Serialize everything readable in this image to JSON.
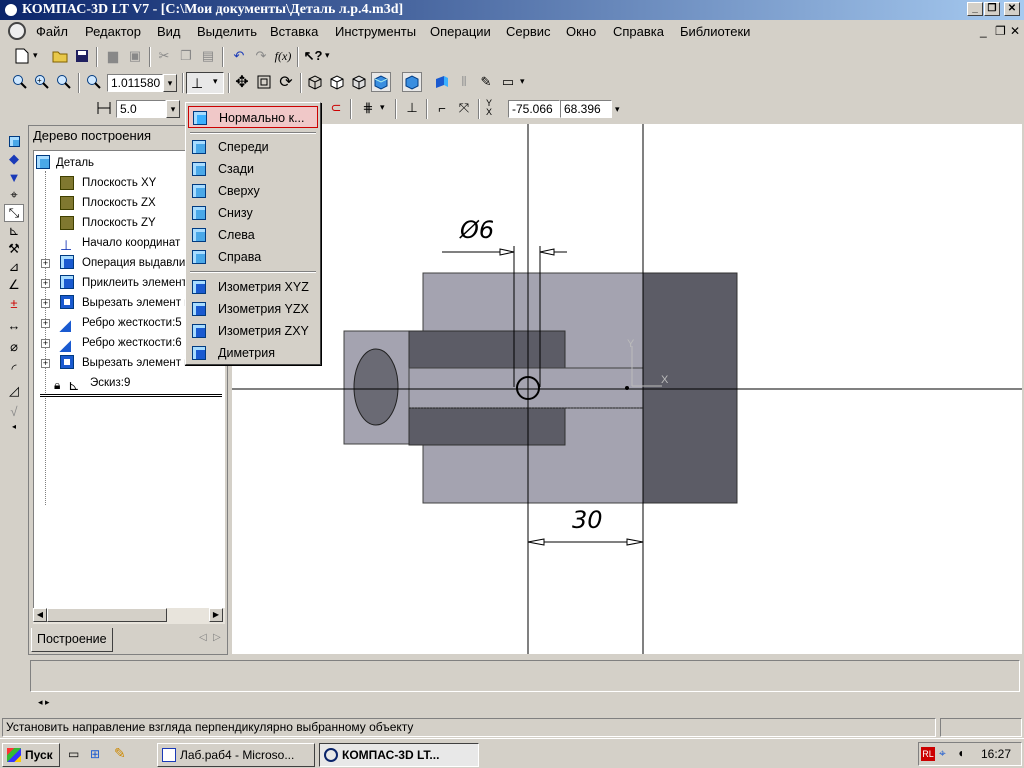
{
  "window": {
    "title": "КОМПАС-3D LT V7 - [C:\\Мои документы\\Деталь л.р.4.m3d]",
    "controls": [
      "_",
      "❐",
      "✕"
    ],
    "doc_controls": [
      "_",
      "❐",
      "✕"
    ]
  },
  "menu": [
    "Файл",
    "Редактор",
    "Вид",
    "Выделить",
    "Вставка",
    "Инструменты",
    "Операции",
    "Сервис",
    "Окно",
    "Справка",
    "Библиотеки"
  ],
  "toolbar2": {
    "zoom_value": "1.011580"
  },
  "toolbar3": {
    "step_value": "5.0",
    "x_label": "X",
    "y_label": "Y",
    "x_value": "-75.066",
    "y_value": "68.396"
  },
  "tree": {
    "header": "Дерево построения",
    "nodes": [
      {
        "label": "Деталь",
        "icon": "part-icon",
        "expand": false
      },
      {
        "label": "Плоскость XY",
        "icon": "plane-icon",
        "expand": false
      },
      {
        "label": "Плоскость ZX",
        "icon": "plane-icon",
        "expand": false
      },
      {
        "label": "Плоскость ZY",
        "icon": "plane-icon",
        "expand": false
      },
      {
        "label": "Начало координат",
        "icon": "origin-icon",
        "expand": false
      },
      {
        "label": "Операция выдавлива",
        "icon": "extrude-icon",
        "expand": true
      },
      {
        "label": "Приклеить элемент",
        "icon": "extrude-icon",
        "expand": true
      },
      {
        "label": "Вырезать элемент в",
        "icon": "cut-icon",
        "expand": true
      },
      {
        "label": "Ребро жесткости:5",
        "icon": "rib-icon",
        "expand": true
      },
      {
        "label": "Ребро жесткости:6",
        "icon": "rib-icon",
        "expand": true
      },
      {
        "label": "Вырезать элемент в",
        "icon": "cut-icon",
        "expand": true
      },
      {
        "label": "Эскиз:9",
        "icon": "sketch-icon",
        "expand": false
      }
    ],
    "tab": "Построение"
  },
  "orientation_menu": {
    "items": [
      {
        "label": "Нормально к...",
        "selected": true
      },
      {
        "label": "Спереди"
      },
      {
        "label": "Сзади"
      },
      {
        "label": "Сверху"
      },
      {
        "label": "Снизу"
      },
      {
        "label": "Слева"
      },
      {
        "label": "Справа"
      },
      {
        "label": "Изометрия XYZ"
      },
      {
        "label": "Изометрия YZX"
      },
      {
        "label": "Изометрия ZXY"
      },
      {
        "label": "Диметрия"
      }
    ]
  },
  "drawing": {
    "dim_diameter": "Ø6",
    "dim_length": "30",
    "axis_y": "Y",
    "axis_x": "X"
  },
  "status": {
    "hint": "Установить направление взгляда перпендикулярно выбранному объекту"
  },
  "taskbar": {
    "start": "Пуск",
    "tasks": [
      "Лаб.раб4 - Microso...",
      "КОМПАС-3D LT..."
    ],
    "time": "16:27",
    "lang": "RL"
  },
  "colors": {
    "title_start": "#0a246a",
    "title_end": "#a6caf0",
    "highlight": "#f0c8c8",
    "part_light": "#a4a3b0",
    "part_dark": "#5c5c66"
  }
}
